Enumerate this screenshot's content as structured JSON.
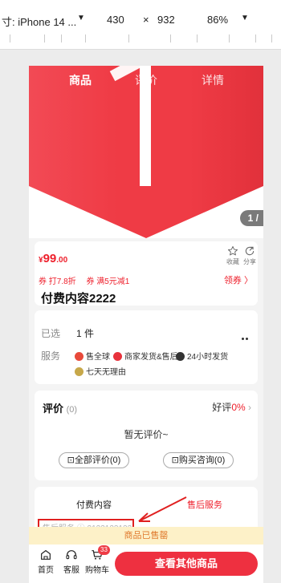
{
  "devtools": {
    "device": "寸: iPhone 14 ...",
    "width": "430",
    "x": "×",
    "height": "932",
    "zoom": "86%",
    "dropdown": "▼"
  },
  "tabs": [
    "商品",
    "评价",
    "详情"
  ],
  "image_counter": "1 /",
  "price": {
    "currency": "¥",
    "integer": "99",
    "decimal": ".00"
  },
  "actions": {
    "fav": "收藏",
    "share": "分享"
  },
  "coupons": [
    "券  打7.8折",
    "券  满5元减1"
  ],
  "coupon_link": "领券 〉",
  "product_name": "付费内容2222",
  "spec": {
    "selected_label": "已选",
    "selected_value": "1 件",
    "service_label": "服务",
    "services": [
      "售全球",
      "商家发货&售后",
      "24小时发货",
      "七天无理由"
    ]
  },
  "review": {
    "title": "评价",
    "count": "(0)",
    "good_label": "好评",
    "good_pct": "0%",
    "empty": "暂无评价~",
    "all_button": "全部评价(0)",
    "consult_button": "购买咨询(0)"
  },
  "info_tabs": {
    "paid": "付费内容",
    "after_sales": "售后服务"
  },
  "highlight_text": "售后服务 ⓘ 2123123123",
  "sold_out": "商品已售罄",
  "bottom": {
    "home": "首页",
    "service": "客服",
    "cart": "购物车",
    "cart_badge": "33",
    "cta": "查看其他商品"
  },
  "colors": {
    "accent": "#ee1f2b",
    "cta": "#ee3040",
    "sold_out_bg": "#fdf1c8"
  }
}
